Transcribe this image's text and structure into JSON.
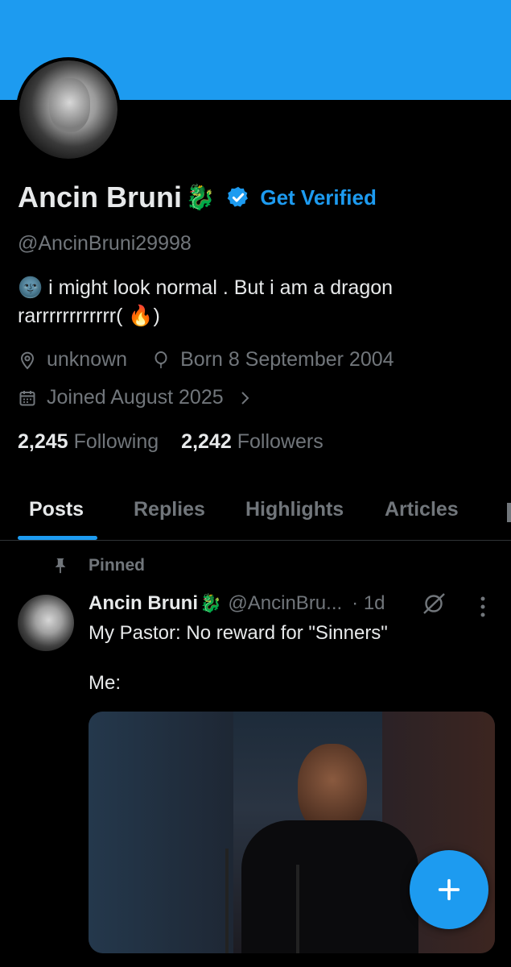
{
  "banner": {
    "color": "#1d9bf0"
  },
  "profile": {
    "display_name": "Ancin Bruni",
    "name_emoji": "🐉",
    "badge_icon": "verified-badge-icon",
    "get_verified_label": "Get Verified",
    "handle": "@AncinBruni29998",
    "bio_line1": "🌚 i might look normal . But i am a dragon",
    "bio_line2": "rarrrrrrrrrrrr( 🔥)",
    "location": "unknown",
    "born": "Born 8 September 2004",
    "joined": "Joined August 2025",
    "following_count": "2,245",
    "following_label": "Following",
    "followers_count": "2,242",
    "followers_label": "Followers"
  },
  "tabs": [
    {
      "label": "Posts",
      "active": true
    },
    {
      "label": "Replies",
      "active": false
    },
    {
      "label": "Highlights",
      "active": false
    },
    {
      "label": "Articles",
      "active": false
    }
  ],
  "pinned_post": {
    "pinned_label": "Pinned",
    "author_name": "Ancin Bruni",
    "author_emoji": "🐉",
    "author_handle": "@AncinBru...",
    "time": "· 1d",
    "text": "My Pastor: No reward for \"Sinners\"\n\nMe:"
  },
  "colors": {
    "accent": "#1d9bf0",
    "background": "#000000",
    "muted": "#71767b",
    "text": "#e7e9ea"
  }
}
